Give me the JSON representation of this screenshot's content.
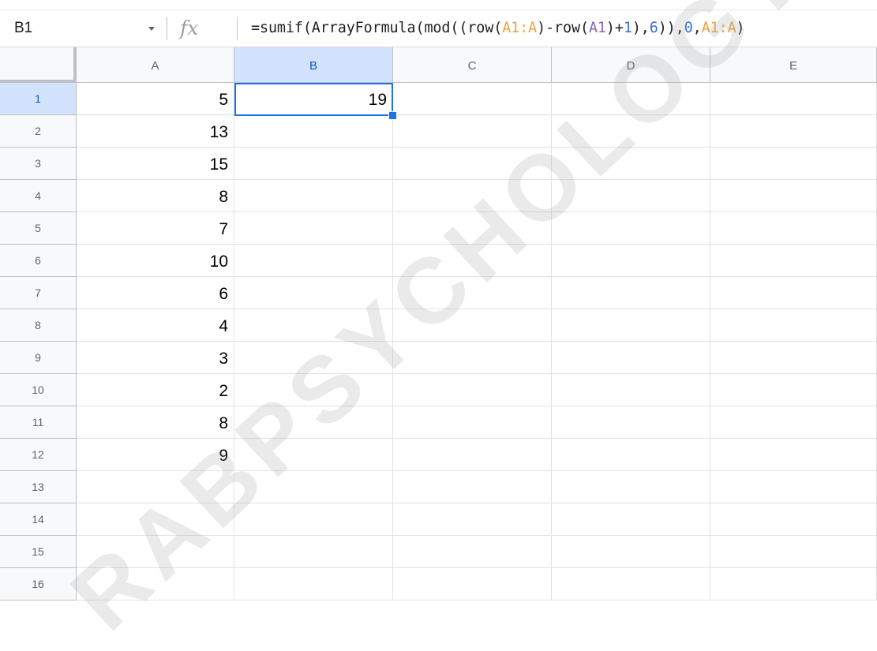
{
  "formula_bar": {
    "name_box": "B1",
    "fx_label": "fx",
    "formula_parts": [
      {
        "text": "=sumif(ArrayFormula(mod((row(",
        "style": "plain"
      },
      {
        "text": "A1:A",
        "style": "ref1"
      },
      {
        "text": ")-row(",
        "style": "plain"
      },
      {
        "text": "A1",
        "style": "ref2"
      },
      {
        "text": ")+",
        "style": "plain"
      },
      {
        "text": "1",
        "style": "num"
      },
      {
        "text": "),",
        "style": "plain"
      },
      {
        "text": "6",
        "style": "num"
      },
      {
        "text": ")),",
        "style": "plain"
      },
      {
        "text": "0",
        "style": "num"
      },
      {
        "text": ",",
        "style": "plain"
      },
      {
        "text": "A1:A",
        "style": "ref1"
      },
      {
        "text": ")",
        "style": "plain"
      }
    ]
  },
  "columns": [
    "A",
    "B",
    "C",
    "D",
    "E"
  ],
  "active_column": "B",
  "row_numbers": [
    "1",
    "2",
    "3",
    "4",
    "5",
    "6",
    "7",
    "8",
    "9",
    "10",
    "11",
    "12",
    "13",
    "14",
    "15",
    "16"
  ],
  "active_row": "1",
  "cells": {
    "A": [
      "5",
      "13",
      "15",
      "8",
      "7",
      "10",
      "6",
      "4",
      "3",
      "2",
      "8",
      "9",
      "",
      "",
      "",
      ""
    ],
    "B": [
      "19",
      "",
      "",
      "",
      "",
      "",
      "",
      "",
      "",
      "",
      "",
      "",
      "",
      "",
      "",
      ""
    ]
  },
  "selected_cell": "B1",
  "watermark": "RABPSYCHOLOGY",
  "colors": {
    "selection": "#1a73e8",
    "ref_range": "#e8a33c",
    "ref_cell": "#8a62b8",
    "number": "#3f6fd8"
  }
}
